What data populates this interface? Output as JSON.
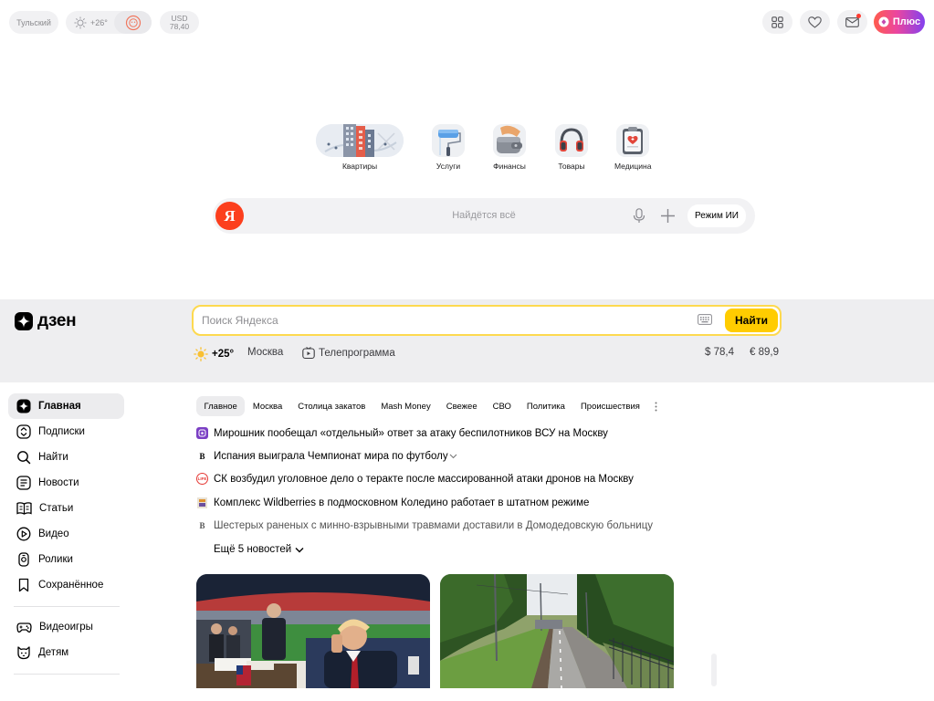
{
  "topbar": {
    "city": "Тульский",
    "temp": "+26°",
    "currency_code": "USD",
    "currency_value": "78,40",
    "plus_label": "Плюс"
  },
  "services": [
    {
      "label": "Квартиры",
      "icon": "building-icon"
    },
    {
      "label": "Услуги",
      "icon": "paint-roller-icon"
    },
    {
      "label": "Финансы",
      "icon": "wallet-icon"
    },
    {
      "label": "Товары",
      "icon": "headphones-icon"
    },
    {
      "label": "Медицина",
      "icon": "medical-clipboard-icon"
    }
  ],
  "search": {
    "placeholder": "Найдётся всё",
    "ai_mode_label": "Режим ИИ"
  },
  "dzen": {
    "logo_text": "дзен",
    "search_placeholder": "Поиск Яндекса",
    "find_label": "Найти",
    "temp": "+25°",
    "city": "Москва",
    "tv_label": "Телепрограмма",
    "usd": "$ 78,4",
    "eur": "€ 89,9"
  },
  "sidebar": {
    "items": [
      {
        "label": "Главная",
        "icon": "home-icon"
      },
      {
        "label": "Подписки",
        "icon": "subscriptions-icon"
      },
      {
        "label": "Найти",
        "icon": "search-icon"
      },
      {
        "label": "Новости",
        "icon": "news-icon"
      },
      {
        "label": "Статьи",
        "icon": "articles-icon"
      },
      {
        "label": "Видео",
        "icon": "video-icon"
      },
      {
        "label": "Ролики",
        "icon": "shorts-icon"
      },
      {
        "label": "Сохранённое",
        "icon": "bookmark-icon"
      }
    ],
    "extra": [
      {
        "label": "Видеоигры",
        "icon": "gamepad-icon"
      },
      {
        "label": "Детям",
        "icon": "kids-icon"
      }
    ]
  },
  "tabs": [
    "Главное",
    "Москва",
    "Столица закатов",
    "Mash Money",
    "Свежее",
    "СВО",
    "Политика",
    "Происшествия"
  ],
  "news": [
    {
      "text": "Мирошник пообещал «отдельный» ответ за атаку беспилотников ВСУ на Москву",
      "source_color": "#7b3fc4",
      "source_glyph": "R"
    },
    {
      "text": "Испания выиграла Чемпионат мира по футболу",
      "source_color": "#ffffff",
      "source_glyph": "B"
    },
    {
      "text": "СК возбудил уголовное дело о теракте после массированной атаки дронов на Москву",
      "source_color": "#e53935",
      "source_glyph": "LIFE"
    },
    {
      "text": "Комплекс Wildberries в подмосковном Коледино работает в штатном режиме",
      "source_color": "#f0b030",
      "source_glyph": "W"
    },
    {
      "text": "Шестерых раненых с минно-взрывными травмами доставили в Домодедовскую больницу",
      "source_color": "#ffffff",
      "source_glyph": "B"
    }
  ],
  "more_news": "Ещё 5 новостей"
}
